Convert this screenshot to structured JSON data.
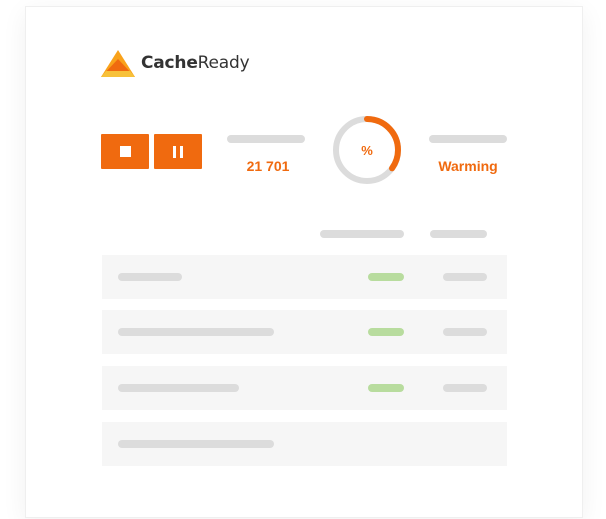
{
  "brand": {
    "name_bold": "Cache",
    "name_light": "Ready",
    "logo_colors": [
      "#f9a21b",
      "#f06a0f",
      "#f7c13a"
    ]
  },
  "controls": {
    "stop_icon": "stop-icon",
    "pause_icon": "pause-icon"
  },
  "metrics": {
    "count_value": "21 701",
    "gauge_symbol": "%",
    "gauge_progress": 0.35,
    "status_value": "Warming"
  },
  "table": {
    "rows": [
      {
        "status": "green"
      },
      {
        "status": "green"
      },
      {
        "status": "green"
      },
      {
        "status": "none"
      }
    ]
  },
  "colors": {
    "accent": "#f06a0f",
    "placeholder": "#dcdcdc",
    "success": "#b8dc9e",
    "row_bg": "#f6f6f6"
  }
}
